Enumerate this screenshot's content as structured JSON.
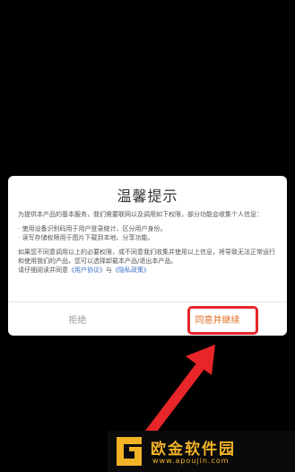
{
  "dialog": {
    "title": "温馨提示",
    "intro": "为提供本产品的基本服务，我们需要联网以及调用如下权限，部分功能会收集个人信息：",
    "items": [
      "· 使用设备识别码用于用户登录统计、区分用户身份。",
      "· 读写存储权限用于图片下载到本地、分享功能。"
    ],
    "notice": "如果您不同意调用以上的必要权限，或不同意我们收集并使用以上信息，将导致无法正常运行和使用我们的产品，您可以选择卸载本产品/退出本产品。",
    "privacy_prefix": "请仔细阅读并同意",
    "user_agreement_link": "《用户协议》",
    "privacy_and": "与",
    "privacy_policy_link": "《隐私政策》",
    "refuse_label": "拒绝",
    "agree_label": "同意并继续"
  },
  "annotation": {
    "highlight_color": "#e8262a"
  },
  "watermark": {
    "brand": "欧金软件园",
    "url": "www.apoujin.com",
    "color": "#f2b326"
  }
}
